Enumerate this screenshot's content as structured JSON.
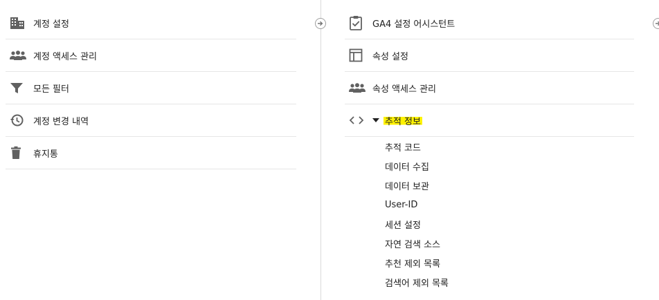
{
  "account_menu": {
    "items": [
      {
        "label": "계정 설정",
        "icon": "building-icon"
      },
      {
        "label": "계정 액세스 관리",
        "icon": "people-icon"
      },
      {
        "label": "모든 필터",
        "icon": "filter-icon"
      },
      {
        "label": "계정 변경 내역",
        "icon": "history-icon"
      },
      {
        "label": "휴지통",
        "icon": "trash-icon"
      }
    ]
  },
  "property_menu": {
    "items": [
      {
        "label": "GA4 설정 어시스턴트",
        "icon": "clipboard-check-icon"
      },
      {
        "label": "속성 설정",
        "icon": "layout-icon"
      },
      {
        "label": "속성 액세스 관리",
        "icon": "people-icon"
      },
      {
        "label": "추적 정보",
        "icon": "code-icon",
        "expanded": true
      }
    ],
    "tracking_subitems": [
      {
        "label": "추적 코드"
      },
      {
        "label": "데이터 수집"
      },
      {
        "label": "데이터 보관"
      },
      {
        "label": "User-ID"
      },
      {
        "label": "세션 설정"
      },
      {
        "label": "자연 검색 소스"
      },
      {
        "label": "추천 제외 목록"
      },
      {
        "label": "검색어 제외 목록"
      }
    ]
  },
  "colors": {
    "icon": "#616161",
    "highlight": "#fff200",
    "divider": "#e6e6e6"
  }
}
